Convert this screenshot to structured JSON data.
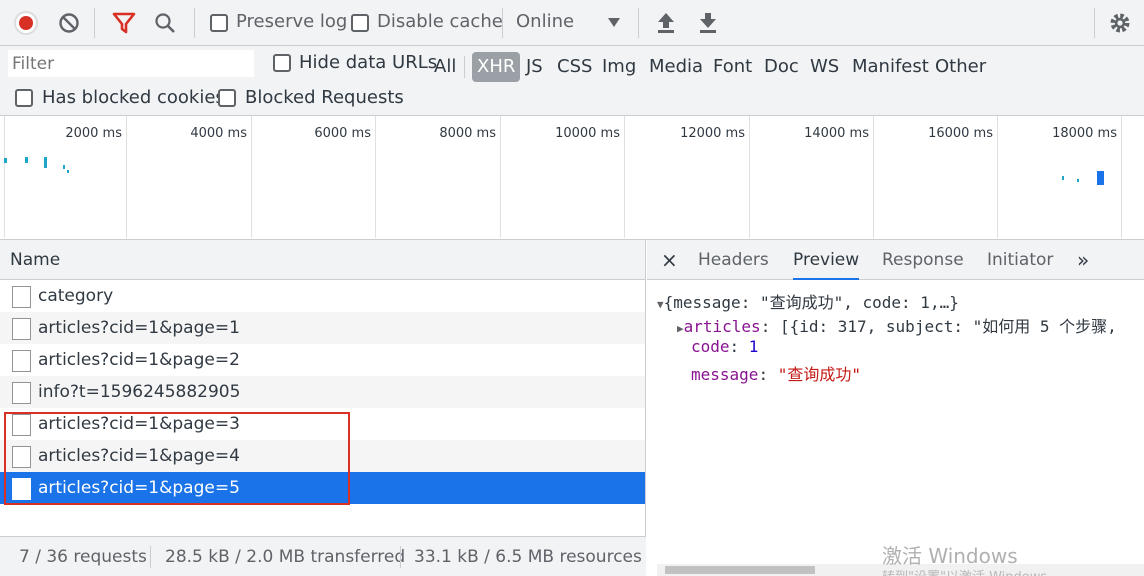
{
  "toolbar": {
    "preserve_log": "Preserve log",
    "disable_cache": "Disable cache",
    "throttle": "Online"
  },
  "filterbar": {
    "filter_placeholder": "Filter",
    "hide_data_urls": "Hide data URLs",
    "types": [
      "All",
      "XHR",
      "JS",
      "CSS",
      "Img",
      "Media",
      "Font",
      "Doc",
      "WS",
      "Manifest",
      "Other"
    ],
    "active_type": "XHR",
    "has_blocked_cookies": "Has blocked cookies",
    "blocked_requests": "Blocked Requests"
  },
  "overview": {
    "ticks": [
      "2000 ms",
      "4000 ms",
      "6000 ms",
      "8000 ms",
      "10000 ms",
      "12000 ms",
      "14000 ms",
      "16000 ms",
      "18000 ms"
    ]
  },
  "requests": {
    "header": "Name",
    "rows": [
      "category",
      "articles?cid=1&page=1",
      "articles?cid=1&page=2",
      "info?t=1596245882905",
      "articles?cid=1&page=3",
      "articles?cid=1&page=4",
      "articles?cid=1&page=5"
    ],
    "selected_index": 6
  },
  "status": {
    "requests": "7 / 36 requests",
    "transferred": "28.5 kB / 2.0 MB transferred",
    "resources": "33.1 kB / 6.5 MB resources"
  },
  "preview": {
    "close_glyph": "×",
    "tabs": [
      "Headers",
      "Preview",
      "Response",
      "Initiator"
    ],
    "more_glyph": "»",
    "active_tab": "Preview",
    "line1_prefix": "{message: ",
    "line1_message": "\"查询成功\"",
    "line1_mid": ", code: ",
    "line1_code": "1",
    "line1_suffix": ",…}",
    "articles_key": "articles",
    "articles_value": "[{id: 317, subject: \"如何用 5 个步骤,",
    "code_key": "code",
    "code_value": "1",
    "message_key": "message",
    "message_value": "\"查询成功\""
  },
  "watermark": {
    "line1": "激活 Windows",
    "line2": "转到\"设置\"以激活 Windows。"
  }
}
